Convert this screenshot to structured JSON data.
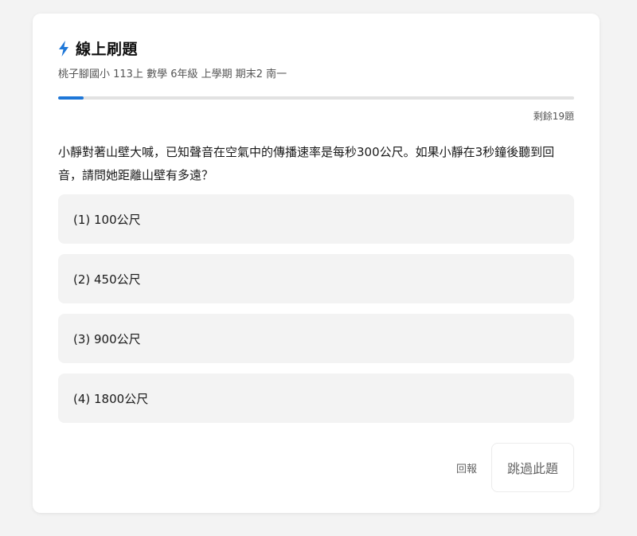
{
  "header": {
    "title": "線上刷題",
    "subtitle": "桃子腳國小 113上 數學 6年級 上學期 期末2 南一",
    "icon": "lightning-bolt-icon",
    "accent_color": "#1e77d8"
  },
  "progress": {
    "fraction": 0.05,
    "remaining_label": "剩餘19題"
  },
  "question": {
    "text": "小靜對著山壁大喊，已知聲音在空氣中的傳播速率是每秒300公尺。如果小靜在3秒鐘後聽到回音，請問她距離山壁有多遠？"
  },
  "options": [
    {
      "label": "(1) 100公尺"
    },
    {
      "label": "(2) 450公尺"
    },
    {
      "label": "(3) 900公尺"
    },
    {
      "label": "(4) 1800公尺"
    }
  ],
  "footer": {
    "report_label": "回報",
    "skip_label": "跳過此題"
  }
}
